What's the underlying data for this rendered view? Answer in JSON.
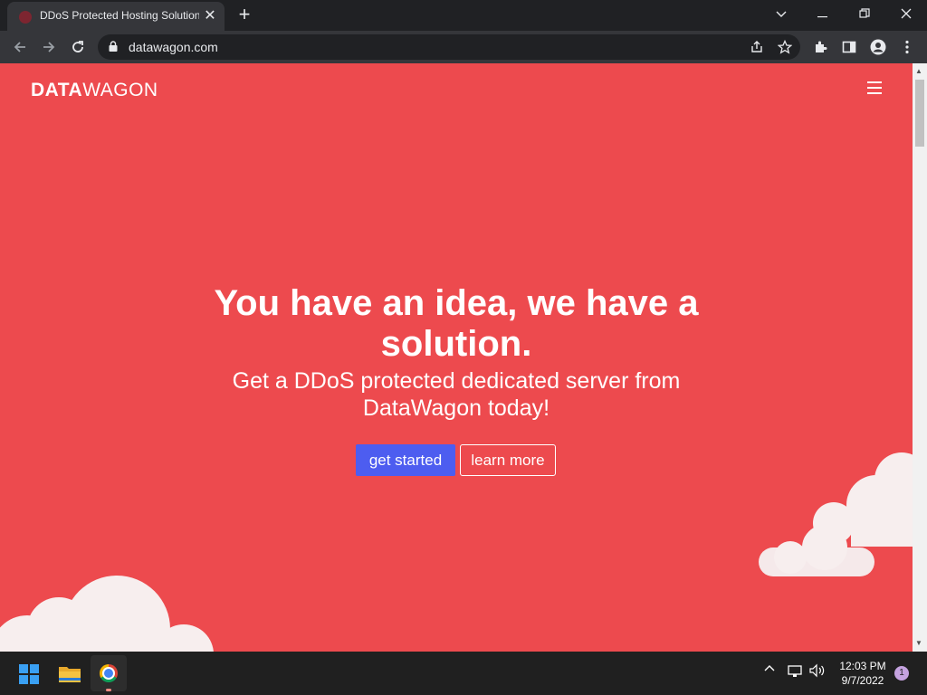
{
  "browser": {
    "tab_title": "DDoS Protected Hosting Solution",
    "tab_close": "✕",
    "new_tab": "+",
    "url": "datawagon.com",
    "window_controls": {
      "dropdown": "⌄",
      "minimize": "—",
      "restore": "❐",
      "close": "✕"
    }
  },
  "site": {
    "logo_bold": "DATA",
    "logo_light": "WAGON",
    "headline": "You have an idea, we have a solution.",
    "subheadline": "Get a DDoS protected dedicated server from DataWagon today!",
    "primary_button": "get started",
    "secondary_button": "learn more",
    "colors": {
      "background": "#ed4a4e",
      "primary_button": "#4d5df0",
      "cloud": "#f7eeee"
    }
  },
  "taskbar": {
    "time": "12:03 PM",
    "date": "9/7/2022",
    "notification_count": "1",
    "apps": [
      "windows-start-icon",
      "file-explorer-icon",
      "chrome-icon"
    ]
  }
}
